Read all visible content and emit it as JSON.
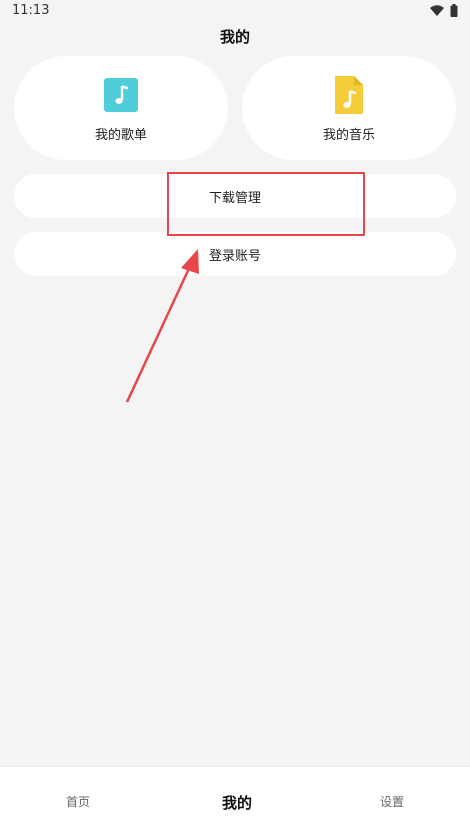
{
  "status_bar": {
    "time": "11:13"
  },
  "header": {
    "title": "我的"
  },
  "cards": {
    "playlist": {
      "label": "我的歌单",
      "icon": "music-note-icon",
      "color": "#4fcdd9"
    },
    "music": {
      "label": "我的音乐",
      "icon": "music-file-icon",
      "color": "#f5cd3a"
    }
  },
  "list": {
    "download": "下载管理",
    "login": "登录账号"
  },
  "bottom_nav": {
    "home": "首页",
    "mine": "我的",
    "settings": "设置"
  },
  "colors": {
    "highlight": "#e8464a",
    "background": "#f4f4f4"
  }
}
